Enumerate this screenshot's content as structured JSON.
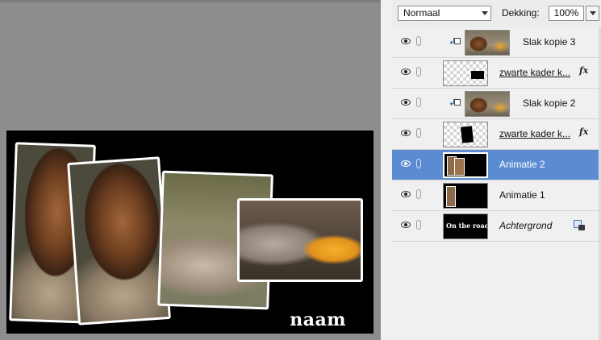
{
  "options_bar": {
    "blend_mode": "Normaal",
    "opacity_label": "Dekking:",
    "opacity_value": "100%"
  },
  "canvas": {
    "overlay_text": "naam"
  },
  "layers": [
    {
      "name": "Slak kopie 3",
      "thumbnail": "snail-photo",
      "clipped": true,
      "effects": false,
      "locked": false,
      "selected": false,
      "style": "normal"
    },
    {
      "name": "zwarte kader k...",
      "thumbnail": "black-frame-transparent",
      "clipped": false,
      "effects": true,
      "locked": false,
      "selected": false,
      "style": "underline"
    },
    {
      "name": "Slak kopie 2",
      "thumbnail": "snail-photo",
      "clipped": true,
      "effects": false,
      "locked": false,
      "selected": false,
      "style": "normal"
    },
    {
      "name": "zwarte kader k...",
      "thumbnail": "black-frame-transparent",
      "clipped": false,
      "effects": true,
      "locked": false,
      "selected": false,
      "style": "underline"
    },
    {
      "name": "Animatie 2",
      "thumbnail": "black-with-photos",
      "clipped": false,
      "effects": false,
      "locked": false,
      "selected": true,
      "style": "normal"
    },
    {
      "name": "Animatie 1",
      "thumbnail": "black-with-photo",
      "clipped": false,
      "effects": false,
      "locked": false,
      "selected": false,
      "style": "normal"
    },
    {
      "name": "Achtergrond",
      "thumbnail": "black-with-text",
      "thumbnail_text": "On the road...",
      "clipped": false,
      "effects": false,
      "locked": true,
      "selected": false,
      "style": "italic"
    }
  ],
  "icons": {
    "visibility": "eye-icon",
    "link": "link-icon",
    "clip": "clipping-mask-icon",
    "effects": "fx-icon",
    "lock": "lock-icon"
  },
  "colors": {
    "selection": "#5b8cd2",
    "canvas_background": "#8d8d8d"
  }
}
